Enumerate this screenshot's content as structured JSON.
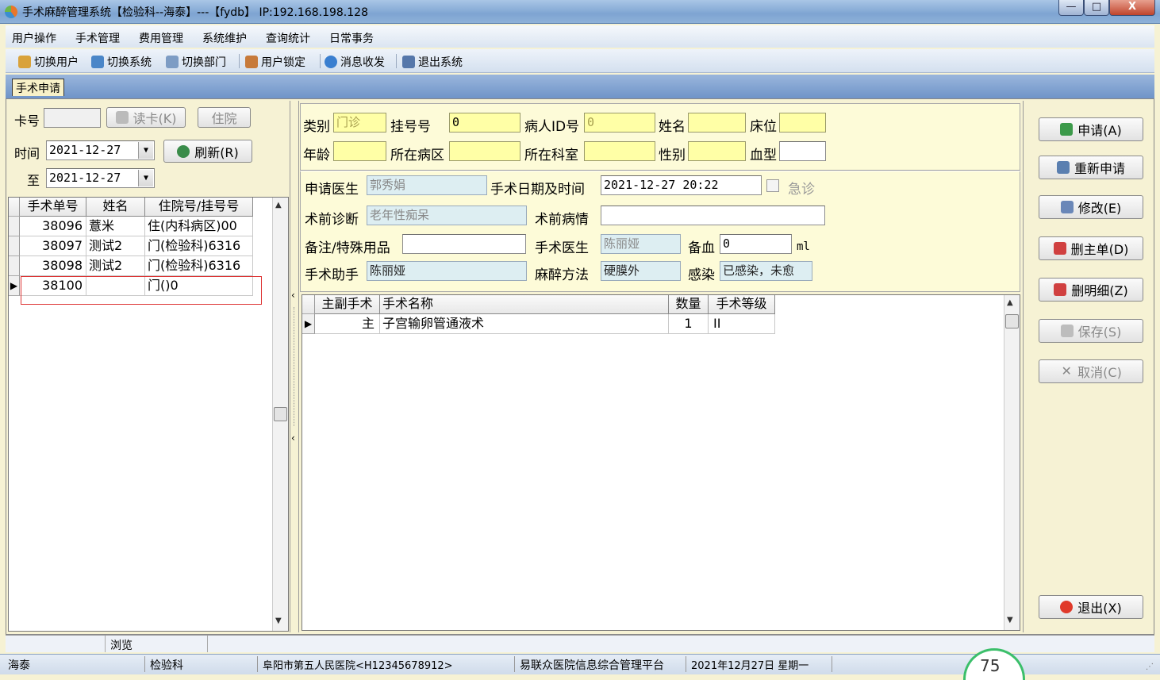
{
  "window": {
    "title": "手术麻醉管理系统【检验科--海泰】---【fydb】 IP:192.168.198.128",
    "min": "—",
    "max": "□",
    "close": "X"
  },
  "menu": [
    "用户操作",
    "手术管理",
    "费用管理",
    "系统维护",
    "查询统计",
    "日常事务"
  ],
  "toolbar": {
    "switch_user": "切换用户",
    "switch_system": "切换系统",
    "switch_dept": "切换部门",
    "user_lock": "用户锁定",
    "messages": "消息收发",
    "exit_system": "退出系统"
  },
  "tab": {
    "label": "手术申请"
  },
  "left": {
    "card_label": "卡号",
    "card_value": "",
    "read_card": "读卡(K)",
    "inpatient": "住院",
    "time_label": "时间",
    "date_from": "2021-12-27",
    "to_label": "至",
    "date_to": "2021-12-27",
    "refresh": "刷新(R)",
    "columns": [
      "手术单号",
      "姓名",
      "住院号/挂号号"
    ],
    "rows": [
      {
        "no": "38096",
        "name": "薏米",
        "reg": "住(内科病区)00"
      },
      {
        "no": "38097",
        "name": "测试2",
        "reg": "门(检验科)6316"
      },
      {
        "no": "38098",
        "name": "测试2",
        "reg": "门(检验科)6316"
      },
      {
        "no": "38100",
        "name": "",
        "reg": "门()0"
      }
    ]
  },
  "form": {
    "category_label": "类别",
    "category_value": "门诊",
    "regno_label": "挂号号",
    "regno_value": "0",
    "patient_id_label": "病人ID号",
    "patient_id_value": "0",
    "name_label": "姓名",
    "name_value": "",
    "bed_label": "床位",
    "bed_value": "",
    "age_label": "年龄",
    "age_value": "",
    "ward_label": "所在病区",
    "ward_value": "",
    "dept_label": "所在科室",
    "dept_value": "",
    "sex_label": "性别",
    "sex_value": "",
    "blood_label": "血型",
    "blood_value": "",
    "doctor_label": "申请医生",
    "doctor_value": "郭秀娟",
    "datetime_label": "手术日期及时间",
    "datetime_value": "2021-12-27 20:22",
    "emergency_label": "急诊",
    "diag_label": "术前诊断",
    "diag_value": "老年性痴呆",
    "condition_label": "术前病情",
    "condition_value": "",
    "remark_label": "备注/特殊用品",
    "remark_value": "",
    "surgeon_label": "手术医生",
    "surgeon_value": "陈丽娅",
    "blood_prep_label": "备血",
    "blood_prep_value": "0",
    "blood_unit": "ml",
    "assistant_label": "手术助手",
    "assistant_value": "陈丽娅",
    "anesthesia_label": "麻醉方法",
    "anesthesia_value": "硬膜外",
    "infection_label": "感染",
    "infection_value": "已感染，未愈"
  },
  "detail": {
    "columns": [
      "主副手术",
      "手术名称",
      "数量",
      "手术等级"
    ],
    "rows": [
      {
        "main": "主",
        "name": "子宫输卵管通液术",
        "qty": "1",
        "level": "II"
      }
    ]
  },
  "actions": {
    "apply": "申请(A)",
    "reapply": "重新申请",
    "modify": "修改(E)",
    "delete_main": "删主单(D)",
    "delete_detail": "删明细(Z)",
    "save": "保存(S)",
    "cancel": "取消(C)",
    "exit": "退出(X)"
  },
  "status_mode": "浏览",
  "statusbar": {
    "user": "海泰",
    "dept": "检验科",
    "hospital": "阜阳市第五人民医院<H12345678912>",
    "platform": "易联众医院信息综合管理平台",
    "date": "2021年12月27日 星期一",
    "gauge": "75"
  },
  "colors": {
    "form_bg": "#f6f2d4",
    "yellow_field": "#ffffa6",
    "blue_field": "#ddeef2",
    "title_bar": "#7ea4d2"
  }
}
